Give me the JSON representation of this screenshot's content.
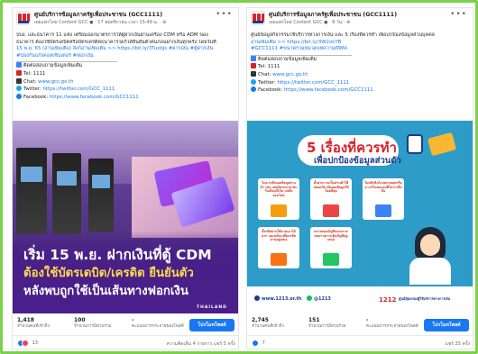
{
  "posts": [
    {
      "page_name": "ศูนย์บริการข้อมูลภาครัฐเพื่อประชาชน (GCC1111)",
      "meta": "เผยแพร่โดย Content GCC ● · 17 พฤศจิกายน เวลา 15:49 น. · ⊕",
      "body_lines": [
        "ปปง. และธนาคาร 11 แห่ง เตรียมออกมาตรการให้ผู้ฝากเงินผ่านเครื่อง CDM หรือ ADM ของ",
        "ธนาคาร ต้องใช้บัตรเดบิตหรือบัตรเครดิตธนาคารใดก็ได้ยืนยันตัวตนก่อนฝากเงินทุกครั้ง โดยวันที่",
        "15 พ.ย. 65 (อ่านเพิ่มเติม) ลิงก์อ่านเพิ่มเติม >> https://bit.ly/3TuxbJs #ฝากเงิน #ตู้ฝากเงิน",
        "#ป้องกันแก๊งคอลเซ็นเตอร์ #ฟอกเงิน"
      ],
      "contact_title": "ติดต่อสอบถามข้อมูลเพิ่มเติม",
      "contacts": [
        {
          "label": "Tel: 1111",
          "link": ""
        },
        {
          "label": "Chat: ",
          "link": "www.gcc.go.th"
        },
        {
          "label": "Twitter: ",
          "link": "https://twitter.com/GCC_1111"
        },
        {
          "label": "Facebook: ",
          "link": "https://www.facebook.com/GCC1111"
        }
      ],
      "image": {
        "headline1": "เริ่ม 15 พ.ย. ฝากเงินที่ตู้ CDM",
        "headline2": "ต้องใช้บัตรเดบิต/เครดิต ยืนยันตัว",
        "headline3": "หลังพบถูกใช้เป็นเส้นทางฟอกเงิน",
        "watermark": "THAILAND"
      },
      "stats": [
        {
          "value": "1,418",
          "label": "จำนวนคนที่เข้าถึง"
        },
        {
          "value": "100",
          "label": "จำนวนการมีส่วนร่วม"
        },
        {
          "value": "-",
          "label": "คะแนนการกระจายของโพสต์"
        }
      ],
      "promote_label": "โปรโมทโพสต์",
      "reaction_count": "13",
      "footer_right": "ความคิดเห็น 4 รายการ  แชร์ 5 ครั้ง"
    },
    {
      "page_name": "ศูนย์บริการข้อมูลภาครัฐเพื่อประชาชน (GCC1111)",
      "meta": "เผยแพร่โดย Content GCC ● · 6 วัน · ⊕",
      "body_lines": [
        "ศูนย์ข้อมูลกิจกรรมใช้บริการทางการเงิน และ 5 เรื่องที่ควรทำ เพื่อปกป้องข้อมูลส่วนบุคคล",
        "อ่านเพิ่มเติม >> https://bit.ly/3W2xkYB",
        "#GCC1111 #ขนาดรวมหมวดบทความดิจิทัล"
      ],
      "contact_title": "ติดต่อสอบถามข้อมูลเพิ่มเติม",
      "contacts": [
        {
          "label": "Tel: 1111",
          "link": ""
        },
        {
          "label": "Chat: ",
          "link": "www.gcc.go.th"
        },
        {
          "label": "Twitter: ",
          "link": "https://twitter.com/GCC_1111"
        },
        {
          "label": "Facebook: ",
          "link": "https://www.facebook.com/GCC1111"
        }
      ],
      "image": {
        "headline1": "5 เรื่องที่ควรทำ",
        "headline2": "เพื่อปกป้องข้อมูลส่วนตัว",
        "tiles": [
          "ไม่ควรเปิดเผยข้อมูลส่วนตัว เช่น เลขบัตรประชาชน วันเดือนปีเกิด บนสื่อออนไลน์",
          "ตั้งค่าความเป็นส่วนตัวให้ปลอดภัย เปิดเผยข้อมูลให้น้อยที่สุด",
          "ไม่คลิกลิงก์แปลกปลอมหรือดาวน์โหลดแอปที่ไม่น่าเชื่อถือ",
          "ตั้งรหัสผ่านให้คาดเดาได้ยาก และหมั่นเปลี่ยนรหัสผ่านอยู่เสมอ",
          "ตรวจสอบบัญชีและตรวจสอบรายการเดินบัญชีอยู่เสมอ"
        ],
        "website": "www.1213.or.th",
        "line": "@1213",
        "hotline": "1212",
        "org": "ศูนย์คุ้มครองผู้ใช้บริการทางการเงิน"
      },
      "stats": [
        {
          "value": "2,745",
          "label": "จำนวนคนที่เข้าถึง"
        },
        {
          "value": "151",
          "label": "จำนวนการมีส่วนร่วม"
        },
        {
          "value": "-",
          "label": "คะแนนการกระจายของโพสต์"
        }
      ],
      "promote_label": "โปรโมทโพสต์",
      "reaction_count": "7",
      "footer_right": "แชร์ 25 ครั้ง"
    }
  ],
  "colors": {
    "frame": "#7bd14a",
    "link": "#1877f2",
    "button": "#1877f2"
  }
}
